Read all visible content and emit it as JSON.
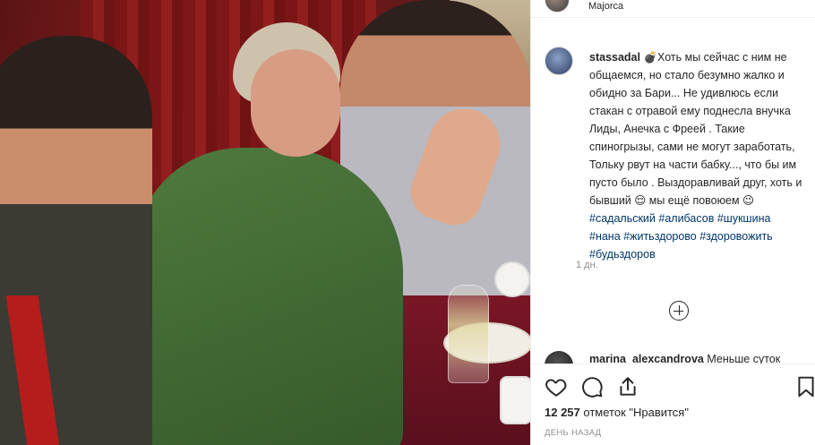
{
  "header": {
    "location": "Majorca"
  },
  "post": {
    "username": "stassadal",
    "caption_parts": [
      {
        "type": "text",
        "value": "💣Хоть мы сейчас с ним не общаемся, но стало безумно жалко и обидно за Бари... Не удивлюсь если стакан с отравой ему поднесла внучка Лиды, Анечка с Фреей . Такие спиногрызы, сами не могут заработать, Тольку рвут на части бабку..., что бы им пусто было . Выздоравливай друг, хоть и бывший 😌 мы ещё повоюем 😉 "
      },
      {
        "type": "hashtag",
        "value": "#садальский"
      },
      {
        "type": "text",
        "value": " "
      },
      {
        "type": "hashtag",
        "value": "#алибасов"
      },
      {
        "type": "text",
        "value": " "
      },
      {
        "type": "hashtag",
        "value": "#шукшина"
      },
      {
        "type": "text",
        "value": " "
      },
      {
        "type": "hashtag",
        "value": "#нана"
      },
      {
        "type": "text",
        "value": " "
      },
      {
        "type": "hashtag",
        "value": "#житьздорово"
      },
      {
        "type": "text",
        "value": " "
      },
      {
        "type": "hashtag",
        "value": "#здоровожить"
      },
      {
        "type": "text",
        "value": " "
      },
      {
        "type": "hashtag",
        "value": "#будьздоров"
      }
    ],
    "time": "1 дн."
  },
  "second_comment": {
    "username": "marina_alexcandrova",
    "text": "Меньше суток"
  },
  "actions": {
    "icons": [
      "heart-icon",
      "comment-icon",
      "share-icon",
      "bookmark-icon"
    ],
    "likes_count": "12 257",
    "likes_label": "отметок \"Нравится\"",
    "ago": "ДЕНЬ НАЗАД"
  },
  "colors": {
    "text": "#262626",
    "hashtag": "#00376b",
    "muted": "#8e8e8e",
    "border": "#efefef"
  }
}
